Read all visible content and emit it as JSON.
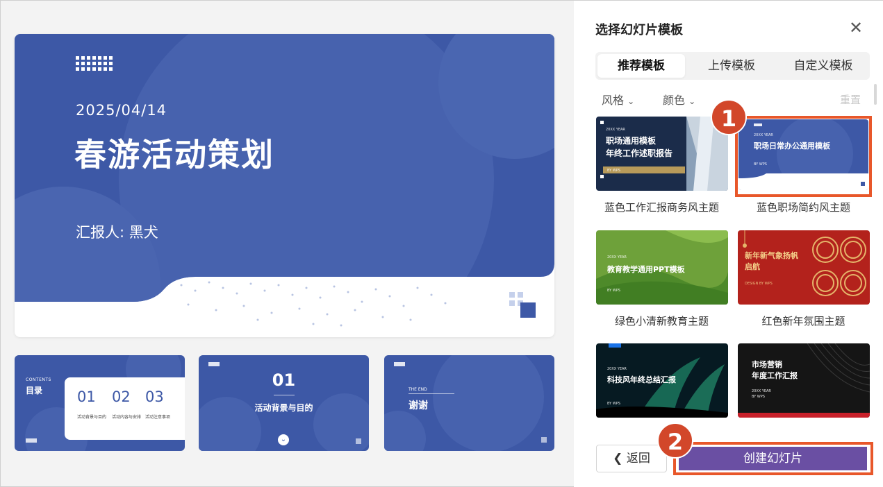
{
  "slide": {
    "date": "2025/04/14",
    "title": "春游活动策划",
    "reporter": "汇报人: 黑犬"
  },
  "thumbs": {
    "toc": {
      "contents": "CONTENTS",
      "heading": "目录",
      "items": [
        {
          "num": "01",
          "text": "活动背景与目的"
        },
        {
          "num": "02",
          "text": "活动内容与安排"
        },
        {
          "num": "03",
          "text": "活动注意事项"
        }
      ]
    },
    "section": {
      "num": "01",
      "label": "活动背景与目的"
    },
    "end": {
      "en": "THE END",
      "title": "谢谢"
    }
  },
  "panel": {
    "title": "选择幻灯片模板",
    "tabs": [
      "推荐模板",
      "上传模板",
      "自定义模板"
    ],
    "filters": [
      "风格",
      "颜色"
    ],
    "reset": "重置",
    "templates": [
      {
        "caption": "蓝色工作汇报商务风主题",
        "year": "20XX YEAR",
        "title_line1": "职场通用模板",
        "title_line2": "年终工作述职报告",
        "by": "BY WPS"
      },
      {
        "caption": "蓝色职场简约风主题",
        "year": "20XX YEAR",
        "title_line1": "职场日常办公通用模板",
        "by": "BY WPS"
      },
      {
        "caption": "绿色小清新教育主题",
        "year": "20XX YEAR",
        "title_line1": "教育教学通用PPT模板",
        "by": "BY WPS"
      },
      {
        "caption": "红色新年氛围主题",
        "title_line1": "新年新气象扬帆",
        "title_line2": "启航",
        "by": "DESIGN BY WPS",
        "big": "20"
      },
      {
        "caption": "",
        "year": "20XX YEAR",
        "title_line1": "科技风年终总结汇报",
        "by": "BY WPS"
      },
      {
        "caption": "",
        "title_line1": "市场营销",
        "title_line2": "年度工作汇报",
        "year": "20XX YEAR",
        "by": "BY WPS"
      }
    ],
    "back_label": "返回",
    "create_label": "创建幻灯片",
    "badges": [
      "1",
      "2"
    ]
  },
  "colors": {
    "accent": "#6a4fa3",
    "highlight": "#e8572a",
    "slide_blue": "#3d58a6"
  }
}
